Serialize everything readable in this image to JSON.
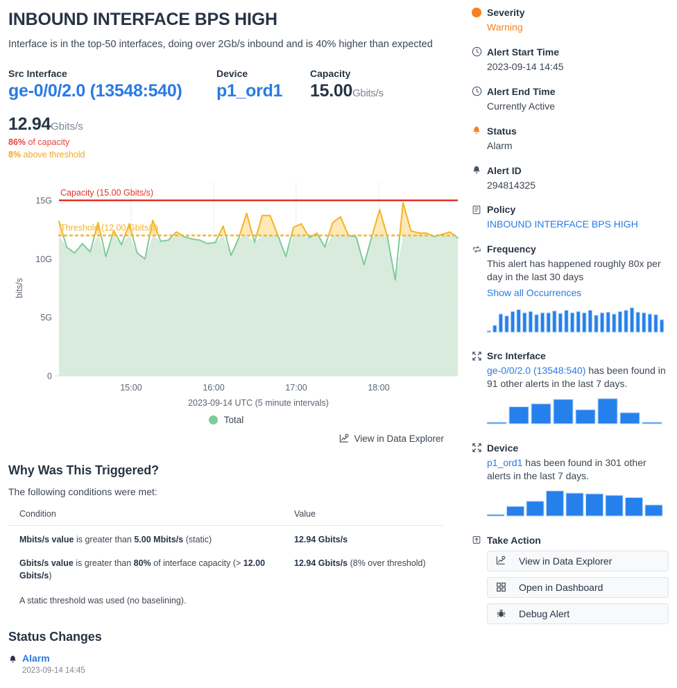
{
  "header": {
    "title": "INBOUND INTERFACE BPS HIGH",
    "subtitle": "Interface is in the top-50 interfaces, doing over 2Gb/s inbound and is 40% higher than expected"
  },
  "facts": {
    "src_interface_label": "Src Interface",
    "src_interface_value": "ge-0/0/2.0 (13548:540)",
    "device_label": "Device",
    "device_value": "p1_ord1",
    "capacity_label": "Capacity",
    "capacity_value": "15.00",
    "capacity_unit": "Gbits/s",
    "current_value": "12.94",
    "current_unit": "Gbits/s",
    "pct_capacity_num": "86%",
    "pct_capacity_text": " of capacity",
    "pct_threshold_num": "8%",
    "pct_threshold_text": " above threshold"
  },
  "chart_data": {
    "type": "area",
    "title": "",
    "xlabel": "2023-09-14 UTC (5 minute intervals)",
    "ylabel": "bits/s",
    "ylim": [
      0,
      16000000000
    ],
    "ytick_values": [
      0,
      5000000000,
      10000000000,
      15000000000
    ],
    "ytick_labels": [
      "0",
      "5G",
      "10G",
      "15G"
    ],
    "xtick_labels": [
      "15:00",
      "16:00",
      "17:00",
      "18:00"
    ],
    "xtick_positions": [
      189,
      308,
      427,
      546
    ],
    "grid": true,
    "legend": [
      {
        "name": "Total",
        "color": "#7ecb9a"
      }
    ],
    "legend_position": "bottom",
    "annotations": [
      {
        "name": "capacity-line",
        "label": "Capacity (15.00 Gbits/s)",
        "value": 15.0,
        "color": "#e0312a",
        "style": "solid"
      },
      {
        "name": "threshold-line",
        "label": "Threshold (12.00 Gbits/s)",
        "value": 12.0,
        "color": "#f5b324",
        "style": "dotted"
      }
    ],
    "series": [
      {
        "name": "Total",
        "unit": "Gbits/s",
        "color": "#7ecb9a",
        "over_color": "#f5b324",
        "values": [
          13.2,
          11.0,
          10.5,
          11.3,
          10.6,
          13.1,
          10.2,
          12.4,
          11.2,
          13.0,
          10.5,
          10.0,
          13.3,
          11.5,
          11.6,
          12.3,
          11.9,
          11.7,
          11.6,
          11.3,
          11.4,
          12.8,
          10.3,
          11.8,
          13.9,
          11.4,
          13.7,
          13.7,
          12.0,
          10.2,
          12.7,
          13.0,
          11.8,
          12.2,
          11.0,
          13.1,
          13.6,
          12.0,
          11.9,
          9.5,
          11.9,
          14.2,
          11.9,
          8.2,
          14.8,
          12.4,
          12.2,
          12.2,
          11.9,
          12.1,
          12.3,
          11.8
        ]
      }
    ]
  },
  "chart_footer": {
    "legend_label": "Total",
    "view_in_data_explorer": "View in Data Explorer"
  },
  "why": {
    "heading": "Why Was This Triggered?",
    "intro": "The following conditions were met:",
    "columns": [
      "Condition",
      "Value"
    ],
    "rows": [
      {
        "condition_parts": [
          {
            "text": "Mbits/s value",
            "bold": true
          },
          {
            "text": " is greater than ",
            "bold": false
          },
          {
            "text": "5.00 Mbits/s",
            "bold": true
          },
          {
            "text": " (static)",
            "bold": false
          }
        ],
        "value_parts": [
          {
            "text": "12.94 Gbits/s",
            "bold": true
          }
        ]
      },
      {
        "condition_parts": [
          {
            "text": "Gbits/s value",
            "bold": true
          },
          {
            "text": " is greater than ",
            "bold": false
          },
          {
            "text": "80%",
            "bold": true
          },
          {
            "text": " of interface capacity (> ",
            "bold": false
          },
          {
            "text": "12.00 Gbits/s",
            "bold": true
          },
          {
            "text": ")",
            "bold": false
          }
        ],
        "value_parts": [
          {
            "text": "12.94 Gbits/s",
            "bold": true
          },
          {
            "text": " (8% over threshold)",
            "bold": false
          }
        ]
      }
    ],
    "footnote": "A static threshold was used (no baselining)."
  },
  "status_changes": {
    "heading": "Status Changes",
    "items": [
      {
        "name": "Alarm",
        "time": "2023-09-14 14:45",
        "icon": "bell-icon"
      }
    ]
  },
  "sidebar": {
    "severity": {
      "label": "Severity",
      "value": "Warning",
      "icon": "severity-dot-icon",
      "color": "#f58220"
    },
    "alert_start": {
      "label": "Alert Start Time",
      "value": "2023-09-14 14:45",
      "icon": "clock-icon"
    },
    "alert_end": {
      "label": "Alert End Time",
      "value": "Currently Active",
      "icon": "clock-icon"
    },
    "status": {
      "label": "Status",
      "value": "Alarm",
      "icon": "bell-alert-icon"
    },
    "alert_id": {
      "label": "Alert ID",
      "value": "294814325",
      "icon": "bell-icon"
    },
    "policy": {
      "label": "Policy",
      "value": "INBOUND INTERFACE BPS HIGH",
      "icon": "policy-icon"
    },
    "frequency": {
      "label": "Frequency",
      "text": "This alert has happened roughly 80x per day in the last 30 days",
      "link": "Show all Occurrences",
      "icon": "repeat-icon",
      "spark_values": [
        4,
        22,
        58,
        52,
        66,
        72,
        62,
        66,
        56,
        62,
        62,
        68,
        60,
        70,
        62,
        66,
        62,
        70,
        54,
        62,
        64,
        58,
        66,
        70,
        78,
        64,
        62,
        58,
        56,
        40
      ]
    },
    "src_interface": {
      "label": "Src Interface",
      "link": "ge-0/0/2.0 (13548:540)",
      "text": " has been found in 91 other alerts in the last 7 days.",
      "icon": "expand-icon",
      "spark_values": [
        4,
        46,
        54,
        66,
        38,
        68,
        30,
        4
      ]
    },
    "device": {
      "label": "Device",
      "link": "p1_ord1",
      "text": " has been found in 301 other alerts in the last 7 days.",
      "icon": "expand-icon",
      "spark_values": [
        4,
        26,
        40,
        68,
        62,
        60,
        56,
        50,
        30
      ]
    },
    "take_action": {
      "label": "Take Action",
      "icon": "take-action-icon",
      "buttons": [
        {
          "label": "View in Data Explorer",
          "icon": "chart-icon"
        },
        {
          "label": "Open in Dashboard",
          "icon": "grid-icon"
        },
        {
          "label": "Debug Alert",
          "icon": "bug-icon"
        }
      ]
    }
  }
}
